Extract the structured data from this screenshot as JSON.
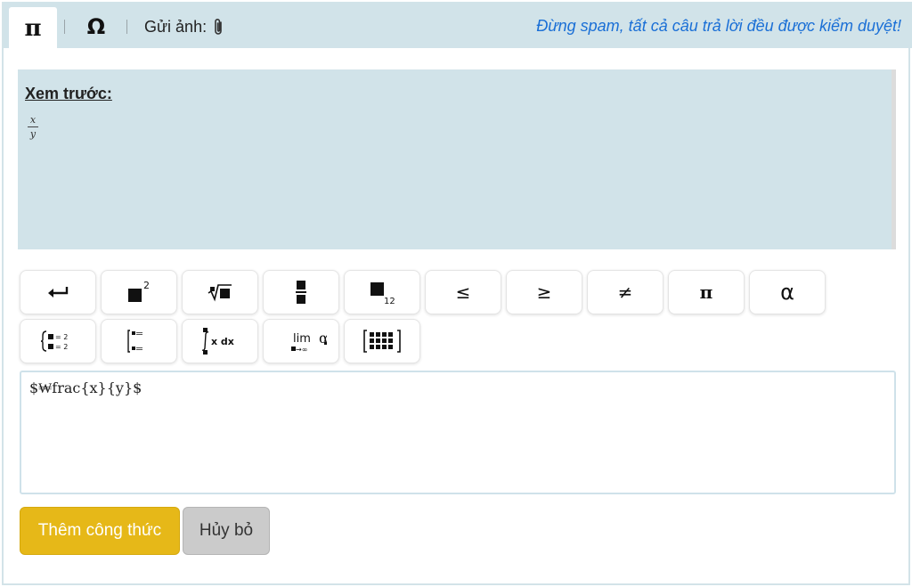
{
  "tabs": {
    "pi_label": "π",
    "omega_label": "Ω",
    "upload_label": "Gửi ảnh:"
  },
  "notice": "Đừng spam, tất cả câu trả lời đều được kiểm duyệt!",
  "preview": {
    "title": "Xem trước:",
    "numerator": "x",
    "denominator": "y"
  },
  "toolbar": {
    "less_equal": "≤",
    "greater_equal": "≥",
    "not_equal": "≠",
    "pi": "π",
    "alpha": "α",
    "square_exponent": "2",
    "subscript_index": "12",
    "integral_text": "x dx",
    "limit_text": "lim",
    "limit_alpha": "α",
    "system_eq_1": "= 2",
    "system_eq_2": "= 2"
  },
  "editor": {
    "value": "$₩frac{x}{y}$"
  },
  "actions": {
    "insert_label": "Thêm công thức",
    "cancel_label": "Hủy bỏ"
  },
  "colors": {
    "tabbar_bg": "#d1e3e9",
    "notice": "#1a6fd6",
    "primary_button": "#e6b818",
    "secondary_button": "#cbcbcb"
  }
}
